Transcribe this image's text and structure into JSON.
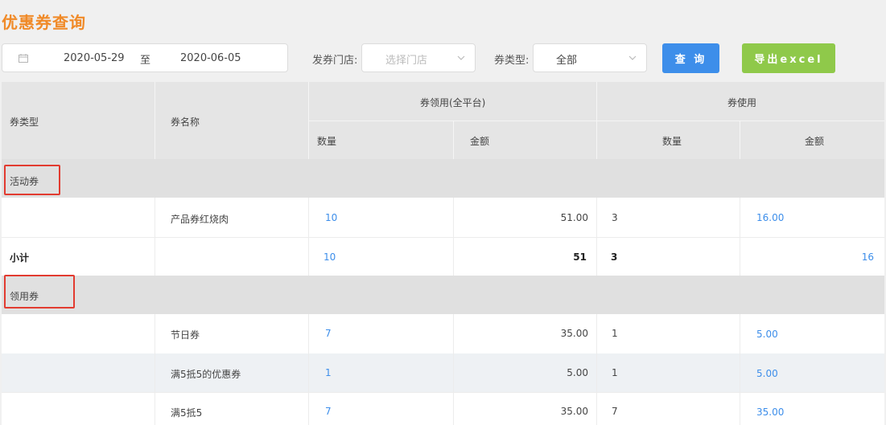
{
  "page_title": "优惠券查询",
  "filters": {
    "start_date": "2020-05-29",
    "date_separator": "至",
    "end_date": "2020-06-05",
    "store_label": "发券门店:",
    "store_placeholder": "选择门店",
    "type_label": "券类型:",
    "type_value": "全部"
  },
  "buttons": {
    "query": "查 询",
    "export": "导出excel"
  },
  "table": {
    "headers": {
      "coupon_type": "券类型",
      "coupon_name": "券名称",
      "claim_group": "券领用(全平台)",
      "use_group": "券使用",
      "claim_qty": "数量",
      "claim_amount": "金额",
      "use_qty": "数量",
      "use_amount": "金额"
    },
    "groups": [
      {
        "name": "活动券",
        "rows": [
          {
            "name": "产品券红烧肉",
            "claim_qty": "10",
            "claim_amount": "51.00",
            "use_qty": "3",
            "use_amount": "16.00"
          }
        ],
        "subtotal": {
          "label": "小计",
          "claim_qty": "10",
          "claim_amount": "51",
          "use_qty": "3",
          "use_amount": "16"
        }
      },
      {
        "name": "领用券",
        "rows": [
          {
            "name": "节日券",
            "claim_qty": "7",
            "claim_amount": "35.00",
            "use_qty": "1",
            "use_amount": "5.00"
          },
          {
            "name": "满5抵5的优惠券",
            "claim_qty": "1",
            "claim_amount": "5.00",
            "use_qty": "1",
            "use_amount": "5.00"
          },
          {
            "name": "满5抵5",
            "claim_qty": "7",
            "claim_amount": "35.00",
            "use_qty": "7",
            "use_amount": "35.00"
          }
        ]
      }
    ]
  },
  "colors": {
    "title": "#f08a28",
    "query_button": "#3d8eea",
    "export_button": "#8fc94a",
    "link_value": "#3d8eea",
    "highlight_box": "#e23b30"
  },
  "icons": {
    "calendar": "calendar-icon",
    "dropdown": "chevron-down-icon"
  }
}
